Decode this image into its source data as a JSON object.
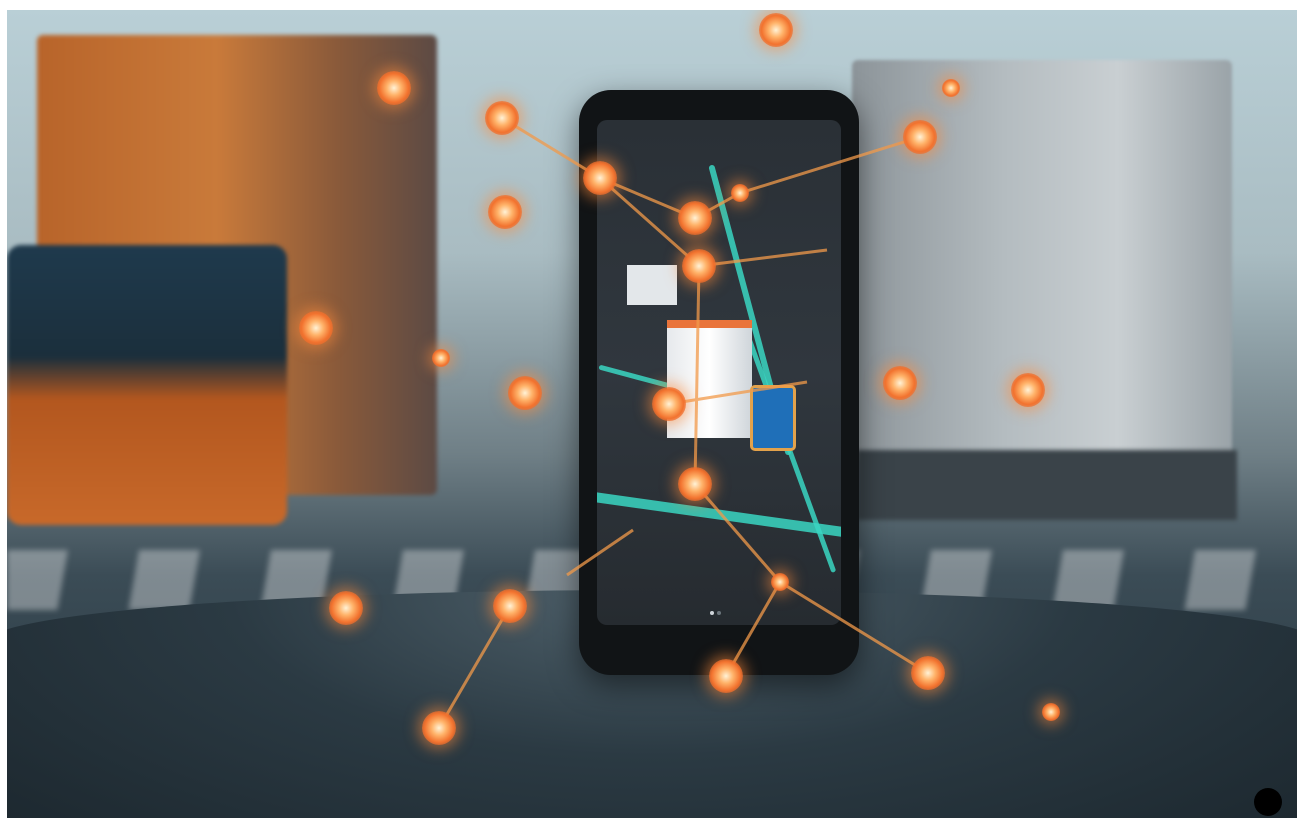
{
  "scene": {
    "description_icon": "photo-icon",
    "accent_color": "#f2722e",
    "map_line_color": "#3ad6c2"
  },
  "corner_button": {
    "icon": "dot-icon"
  }
}
